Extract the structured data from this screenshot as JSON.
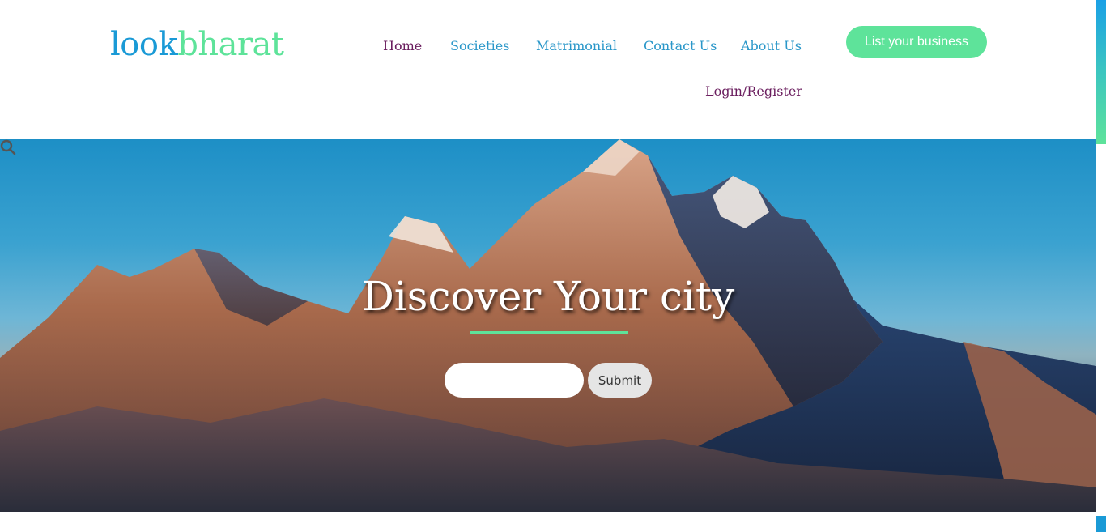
{
  "logo": {
    "part1": "look",
    "part2": "bharat"
  },
  "nav": {
    "home": "Home",
    "societies": "Societies",
    "matrimonial": "Matrimonial",
    "contact": "Contact Us",
    "about": "About Us",
    "login": "Login/Register"
  },
  "cta": {
    "label": "List your business"
  },
  "hero": {
    "title": "Discover Your city",
    "search_placeholder": "",
    "search_icon": "search-icon",
    "submit_label": "Submit"
  },
  "colors": {
    "brand_blue": "#1a9ad6",
    "brand_green": "#5ee39a",
    "nav_active": "#6a1d5e",
    "nav_link": "#2a97c9"
  }
}
